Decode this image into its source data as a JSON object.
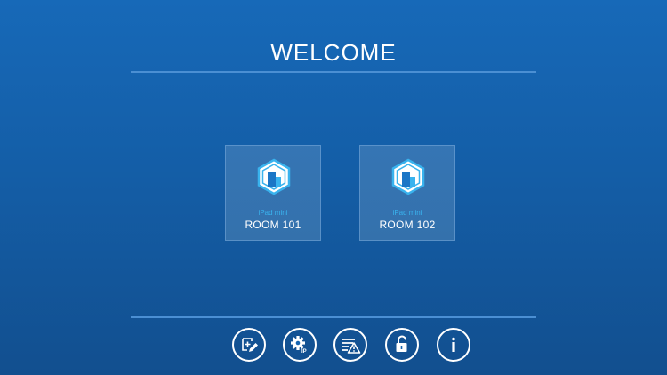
{
  "header": {
    "title": "WELCOME"
  },
  "rooms": [
    {
      "device": "iPad mini",
      "label": "ROOM 101",
      "icon": "building-hexagon-icon"
    },
    {
      "device": "iPad mini",
      "label": "ROOM 102",
      "icon": "building-hexagon-icon"
    }
  ],
  "toolbar": {
    "buttons": [
      {
        "icon": "add-edit-icon"
      },
      {
        "icon": "ip-settings-gear-icon"
      },
      {
        "icon": "alarm-list-warning-icon"
      },
      {
        "icon": "unlock-icon"
      },
      {
        "icon": "info-icon"
      }
    ]
  },
  "colors": {
    "background_top": "#1769b8",
    "background_bottom": "#124f8f",
    "accent": "#39b3ee",
    "divider": "#4b8fd3"
  }
}
